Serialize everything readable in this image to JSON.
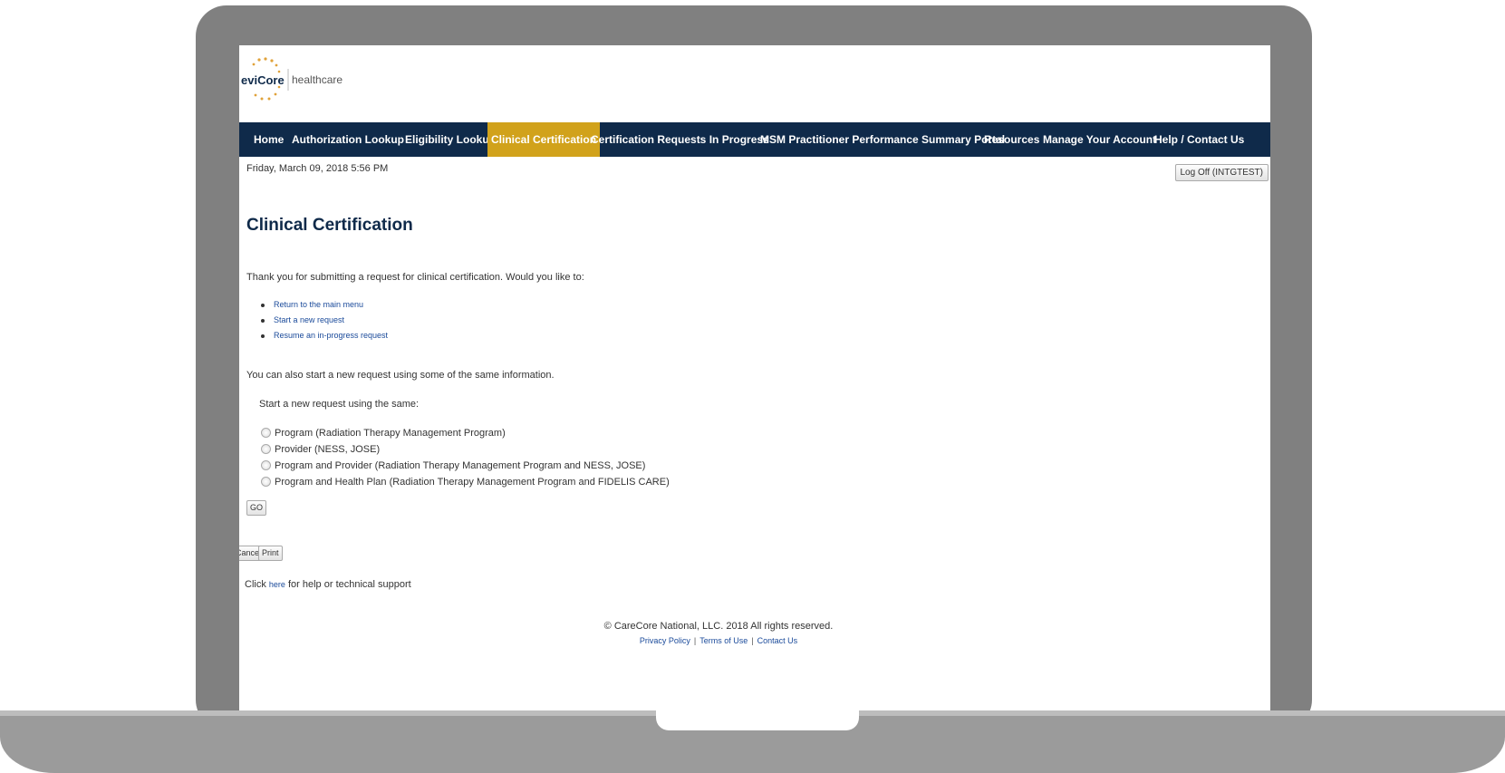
{
  "brand": {
    "name": "eviCore",
    "suffix": "healthcare"
  },
  "nav": {
    "items": [
      "Home",
      "Authorization Lookup",
      "Eligibility Lookup",
      "Clinical Certification",
      "Certification Requests In Progress",
      "MSM Practitioner Performance Summary Portal",
      "Resources",
      "Manage Your Account",
      "Help / Contact Us"
    ],
    "active": "Clinical Certification"
  },
  "header": {
    "datetime": "Friday, March 09, 2018 5:56 PM",
    "logoff_label": "Log Off (INTGTEST)"
  },
  "page": {
    "title": "Clinical Certification",
    "intro": "Thank you for submitting a request for clinical certification. Would you like to:",
    "actions": [
      "Return to the main menu",
      "Start a new request",
      "Resume an in-progress request"
    ],
    "also_text": "You can also start a new request using some of the same information.",
    "same_label": "Start a new request using the same:",
    "options": [
      "Program (Radiation Therapy Management Program)",
      "Provider (NESS, JOSE)",
      "Program and Provider (Radiation Therapy Management Program and NESS, JOSE)",
      "Program and Health Plan (Radiation Therapy Management Program and FIDELIS CARE)"
    ],
    "go_label": "GO",
    "cancel_label": "Cancel",
    "print_label": "Print",
    "help_prefix": "Click",
    "help_link": "here",
    "help_suffix": "for help or technical support"
  },
  "footer": {
    "copyright": "© CareCore National, LLC. 2018 All rights reserved.",
    "links": [
      "Privacy Policy",
      "Terms of Use",
      "Contact Us"
    ]
  },
  "colors": {
    "nav_bg": "#0f2a4a",
    "nav_active": "#d1a21b",
    "link": "#1a4a9a",
    "frame": "#808080"
  }
}
